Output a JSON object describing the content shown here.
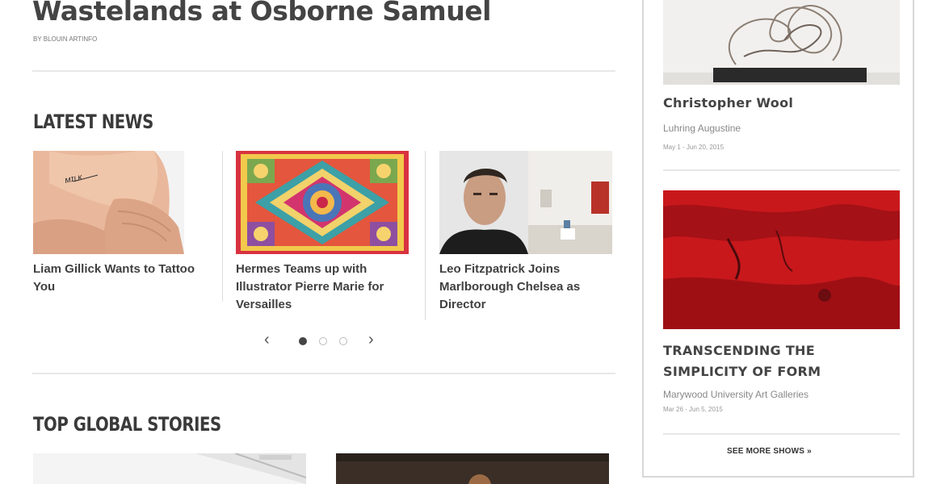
{
  "article": {
    "headline": "Wastelands at Osborne Samuel",
    "byline": "BY BLOUIN ARTINFO"
  },
  "latest_news": {
    "title": "LATEST NEWS",
    "items": [
      {
        "title": "Liam Gillick Wants to Tattoo You"
      },
      {
        "title": "Hermes Teams up with Illustrator Pierre Marie for Versailles"
      },
      {
        "title": "Leo Fitzpatrick Joins Marlborough Chelsea as Director"
      }
    ],
    "prev_icon": "chevron-left-icon",
    "next_icon": "chevron-right-icon",
    "prev_glyph": "‹",
    "next_glyph": "›",
    "active_slide": 1,
    "slide_count": 3
  },
  "top_global": {
    "title": "TOP GLOBAL STORIES"
  },
  "sidebar": {
    "shows": [
      {
        "title": "Christopher Wool",
        "venue": "Luhring Augustine",
        "dates": "May 1 - Jun 20, 2015"
      },
      {
        "title": "TRANSCENDING THE SIMPLICITY OF FORM",
        "venue": "Marywood University Art Galleries",
        "dates": "Mar 26 - Jun 5, 2015"
      }
    ],
    "see_more": "SEE MORE SHOWS »"
  },
  "colors": {
    "text": "#404040",
    "border": "#d7d7d7",
    "red_artwork": "#c0191c"
  }
}
